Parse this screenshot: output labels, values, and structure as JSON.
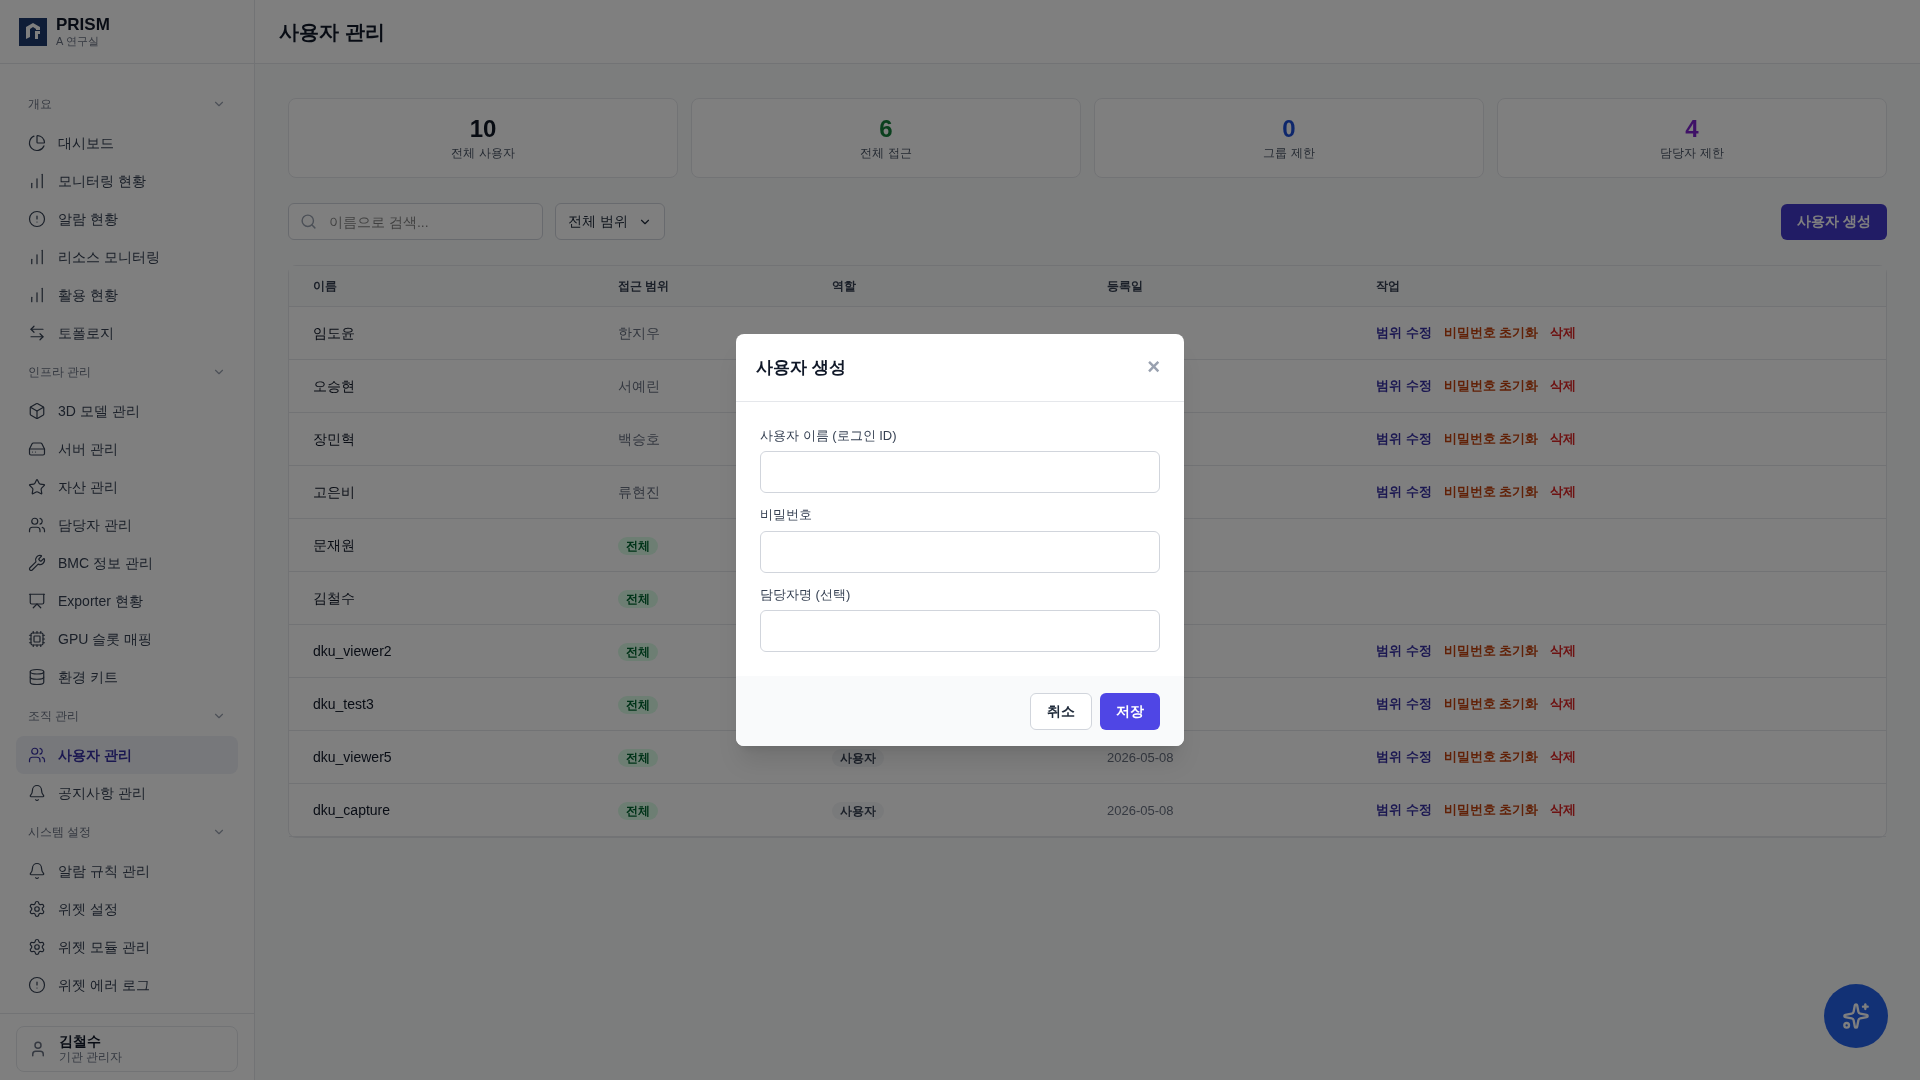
{
  "sidebar": {
    "brand": {
      "name": "PRISM",
      "subtitle": "A 연구실"
    },
    "sections": [
      {
        "title": "개요",
        "expanded": true,
        "items": [
          {
            "label": "대시보드",
            "selected": false
          },
          {
            "label": "모니터링 현황",
            "selected": false
          },
          {
            "label": "알람 현황",
            "selected": false
          },
          {
            "label": "리소스 모니터링",
            "selected": false
          },
          {
            "label": "활용 현황",
            "selected": false
          },
          {
            "label": "토폴로지",
            "selected": false
          }
        ]
      },
      {
        "title": "인프라 관리",
        "expanded": true,
        "items": [
          {
            "label": "3D 모델 관리",
            "selected": false
          },
          {
            "label": "서버 관리",
            "selected": false
          },
          {
            "label": "자산 관리",
            "selected": false
          },
          {
            "label": "담당자 관리",
            "selected": false
          },
          {
            "label": "BMC 정보 관리",
            "selected": false
          },
          {
            "label": "Exporter 현황",
            "selected": false
          },
          {
            "label": "GPU 슬롯 매핑",
            "selected": false
          },
          {
            "label": "환경 키트",
            "selected": false
          }
        ]
      },
      {
        "title": "조직 관리",
        "expanded": true,
        "items": [
          {
            "label": "사용자 관리",
            "selected": true
          },
          {
            "label": "공지사항 관리",
            "selected": false
          }
        ]
      },
      {
        "title": "시스템 설정",
        "expanded": true,
        "items": [
          {
            "label": "알람 규칙 관리",
            "selected": false
          },
          {
            "label": "위젯 설정",
            "selected": false
          },
          {
            "label": "위젯 모듈 관리",
            "selected": false
          },
          {
            "label": "위젯 에러 로그",
            "selected": false
          }
        ]
      }
    ],
    "user": {
      "name": "김철수",
      "role": "기관 관리자"
    }
  },
  "header": {
    "title": "사용자 관리"
  },
  "stats": [
    {
      "value": "10",
      "label": "전체 사용자",
      "color": "#080c13"
    },
    {
      "value": "6",
      "label": "전체 접근",
      "color": "#0b401e"
    },
    {
      "value": "0",
      "label": "그룹 제한",
      "color": "#0e276c"
    },
    {
      "value": "4",
      "label": "담당자 제한",
      "color": "#3f1167"
    }
  ],
  "toolbar": {
    "search": {
      "placeholder": "이름으로 검색..."
    },
    "scope_filter": {
      "value": "전체 범위"
    },
    "create_button": "사용자 생성"
  },
  "table": {
    "columns": [
      "이름",
      "접근 범위",
      "역할",
      "등록일",
      "작업"
    ],
    "rows": [
      {
        "name": "임도윤",
        "scope": {
          "kind": "text",
          "text": "한지우"
        },
        "actions": [
          {
            "kind": "edit",
            "label": "범위 수정"
          },
          {
            "kind": "reset",
            "label": "비밀번호 초기화"
          },
          {
            "kind": "delete",
            "label": "삭제"
          }
        ]
      },
      {
        "name": "오승현",
        "scope": {
          "kind": "text",
          "text": "서예린"
        },
        "actions": [
          {
            "kind": "edit",
            "label": "범위 수정"
          },
          {
            "kind": "reset",
            "label": "비밀번호 초기화"
          },
          {
            "kind": "delete",
            "label": "삭제"
          }
        ]
      },
      {
        "name": "장민혁",
        "scope": {
          "kind": "text",
          "text": "백승호"
        },
        "actions": [
          {
            "kind": "edit",
            "label": "범위 수정"
          },
          {
            "kind": "reset",
            "label": "비밀번호 초기화"
          },
          {
            "kind": "delete",
            "label": "삭제"
          }
        ]
      },
      {
        "name": "고은비",
        "scope": {
          "kind": "text",
          "text": "류현진"
        },
        "actions": [
          {
            "kind": "edit",
            "label": "범위 수정"
          },
          {
            "kind": "reset",
            "label": "비밀번호 초기화"
          },
          {
            "kind": "delete",
            "label": "삭제"
          }
        ]
      },
      {
        "name": "문재원",
        "scope": {
          "kind": "badge",
          "text": "전체"
        }
      },
      {
        "name": "김철수",
        "scope": {
          "kind": "badge",
          "text": "전체"
        }
      },
      {
        "name": "dku_viewer2",
        "scope": {
          "kind": "badge",
          "text": "전체"
        },
        "actions": [
          {
            "kind": "edit",
            "label": "범위 수정"
          },
          {
            "kind": "reset",
            "label": "비밀번호 초기화"
          },
          {
            "kind": "delete",
            "label": "삭제"
          }
        ]
      },
      {
        "name": "dku_test3",
        "scope": {
          "kind": "badge",
          "text": "전체"
        },
        "actions": [
          {
            "kind": "edit",
            "label": "범위 수정"
          },
          {
            "kind": "reset",
            "label": "비밀번호 초기화"
          },
          {
            "kind": "delete",
            "label": "삭제"
          }
        ]
      },
      {
        "name": "dku_viewer5",
        "scope": {
          "kind": "badge",
          "text": "전체"
        },
        "role": "사용자",
        "date": "2026-05-08",
        "actions": [
          {
            "kind": "edit",
            "label": "범위 수정"
          },
          {
            "kind": "reset",
            "label": "비밀번호 초기화"
          },
          {
            "kind": "delete",
            "label": "삭제"
          }
        ]
      },
      {
        "name": "dku_capture",
        "scope": {
          "kind": "badge",
          "text": "전체"
        },
        "role": "사용자",
        "date": "2026-05-08",
        "actions": [
          {
            "kind": "edit",
            "label": "범위 수정"
          },
          {
            "kind": "reset",
            "label": "비밀번호 초기화"
          },
          {
            "kind": "delete",
            "label": "삭제"
          }
        ]
      }
    ]
  },
  "modal": {
    "title": "사용자 생성",
    "close": "×",
    "fields": [
      {
        "label": "사용자 이름 (로그인 ID)"
      },
      {
        "label": "비밀번호"
      },
      {
        "label": "담당자명 (선택)"
      }
    ],
    "buttons": [
      {
        "kind": "secondary",
        "label": "취소"
      },
      {
        "kind": "primary",
        "label": "저장"
      }
    ]
  }
}
